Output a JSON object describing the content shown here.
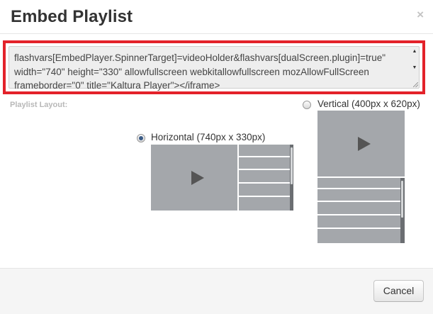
{
  "dialog": {
    "title": "Embed Playlist",
    "close_glyph": "×"
  },
  "embed": {
    "code": "flashvars[EmbedPlayer.SpinnerTarget]=videoHolder&flashvars[dualScreen.plugin]=true\"\nwidth=\"740\" height=\"330\" allowfullscreen webkitallowfullscreen mozAllowFullScreen\nframeborder=\"0\" title=\"Kaltura Player\"></iframe>",
    "highlight_color": "#e3222a"
  },
  "layout": {
    "label": "Playlist Layout:",
    "options": [
      {
        "label": "Horizontal (740px x 330px)",
        "selected": true
      },
      {
        "label": "Vertical (400px x 620px)",
        "selected": false
      }
    ]
  },
  "icons": {
    "play": "play-icon",
    "close": "close-icon"
  },
  "footer": {
    "cancel_label": "Cancel"
  }
}
